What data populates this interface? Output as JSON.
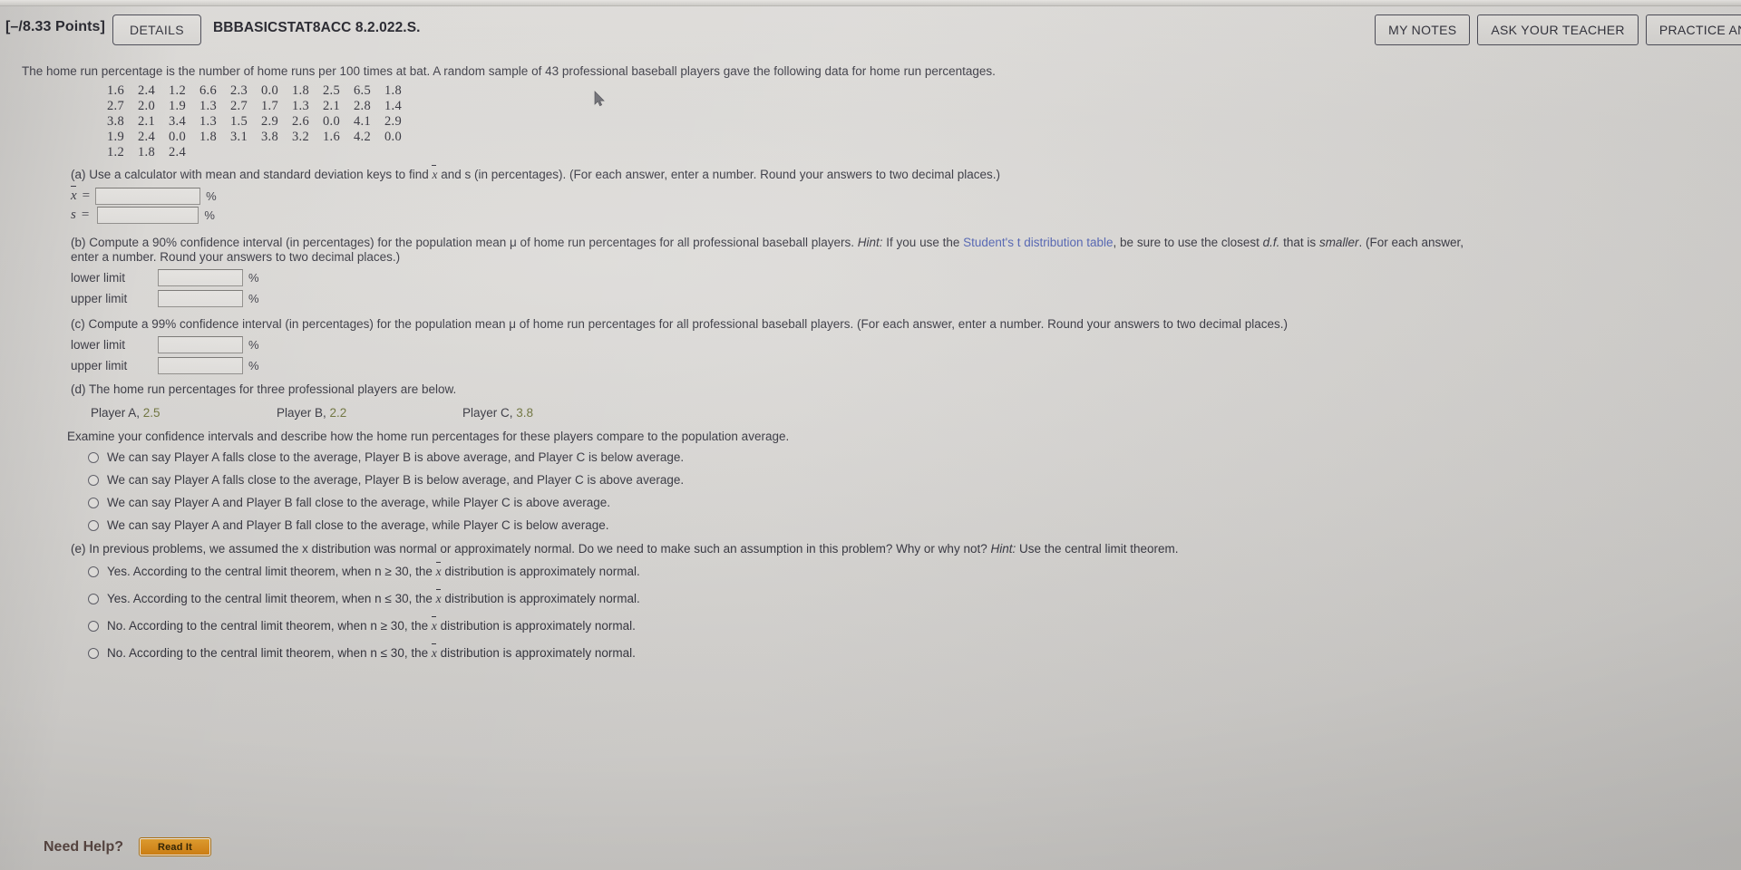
{
  "header": {
    "points": "[–/8.33 Points]",
    "details_label": "DETAILS",
    "question_code": "BBBASICSTAT8ACC 8.2.022.S.",
    "my_notes_label": "MY NOTES",
    "ask_teacher_label": "ASK YOUR TEACHER",
    "practice_label": "PRACTICE ANOTHER"
  },
  "question": {
    "intro": "The home run percentage is the number of home runs per 100 times at bat. A random sample of 43 professional baseball players gave the following data for home run percentages.",
    "data_rows": [
      [
        "1.6",
        "2.4",
        "1.2",
        "6.6",
        "2.3",
        "0.0",
        "1.8",
        "2.5",
        "6.5",
        "1.8"
      ],
      [
        "2.7",
        "2.0",
        "1.9",
        "1.3",
        "2.7",
        "1.7",
        "1.3",
        "2.1",
        "2.8",
        "1.4"
      ],
      [
        "3.8",
        "2.1",
        "3.4",
        "1.3",
        "1.5",
        "2.9",
        "2.6",
        "0.0",
        "4.1",
        "2.9"
      ],
      [
        "1.9",
        "2.4",
        "0.0",
        "1.8",
        "3.1",
        "3.8",
        "3.2",
        "1.6",
        "4.2",
        "0.0"
      ],
      [
        "1.2",
        "1.8",
        "2.4"
      ]
    ]
  },
  "part_a": {
    "prompt_1": "(a) Use a calculator with mean and standard deviation keys to find ",
    "prompt_xbar": "x",
    "prompt_2": " and s (in percentages). (For each answer, enter a number. Round your answers to two decimal places.)",
    "xbar_label": "x",
    "xbar_eq": "=",
    "xbar_value": "",
    "s_label": "s",
    "s_eq": "=",
    "s_value": "",
    "percent": "%"
  },
  "part_b": {
    "line_1": "(b) Compute a 90% confidence interval (in percentages) for the population mean μ of home run percentages for all professional baseball players. ",
    "hint_label": "Hint:",
    "line_1b": " If you use the ",
    "link_text": "Student's t distribution table",
    "line_1c": ", be sure to use the closest ",
    "df_text": "d.f.",
    "line_1d": " that is ",
    "smaller_text": "smaller",
    "line_1e": ". (For each answer,",
    "line_2": "enter a number. Round your answers to two decimal places.)",
    "lower_label": "lower limit",
    "upper_label": "upper limit",
    "lower_value": "",
    "upper_value": "",
    "percent": "%"
  },
  "part_c": {
    "line_1": "(c) Compute a 99% confidence interval (in percentages) for the population mean μ of home run percentages for all professional baseball players. (For each answer, enter a number. Round your answers to two decimal places.)",
    "lower_label": "lower limit",
    "upper_label": "upper limit",
    "lower_value": "",
    "upper_value": "",
    "percent": "%"
  },
  "part_d": {
    "prompt": "(d) The home run percentages for three professional players are below.",
    "players": [
      {
        "name": "Player A,",
        "value": "2.5"
      },
      {
        "name": "Player B,",
        "value": "2.2"
      },
      {
        "name": "Player C,",
        "value": "3.8"
      }
    ],
    "examine": "Examine your confidence intervals and describe how the home run percentages for these players compare to the population average.",
    "options": [
      "We can say Player A falls close to the average, Player B is above average, and Player C is below average.",
      "We can say Player A falls close to the average, Player B is below average, and Player C is above average.",
      "We can say Player A and Player B fall close to the average, while Player C is above average.",
      "We can say Player A and Player B fall close to the average, while Player C is below average."
    ]
  },
  "part_e": {
    "prompt_1": "(e) In previous problems, we assumed the x distribution was normal or approximately normal. Do we need to make such an assumption in this problem? Why or why not? ",
    "hint_label": "Hint:",
    "prompt_2": " Use the central limit theorem.",
    "options": [
      {
        "pre": "Yes. According to the central limit theorem, when n ≥ 30, the ",
        "xbar": "x",
        "post": " distribution is approximately normal."
      },
      {
        "pre": "Yes. According to the central limit theorem, when n ≤ 30, the ",
        "xbar": "x",
        "post": " distribution is approximately normal."
      },
      {
        "pre": "No. According to the central limit theorem, when n ≥ 30, the ",
        "xbar": "x",
        "post": " distribution is approximately normal."
      },
      {
        "pre": "No. According to the central limit theorem, when n ≤ 30, the ",
        "xbar": "x",
        "post": " distribution is approximately normal."
      }
    ]
  },
  "footer": {
    "need_help_label": "Need Help?",
    "read_it_label": "Read It"
  }
}
